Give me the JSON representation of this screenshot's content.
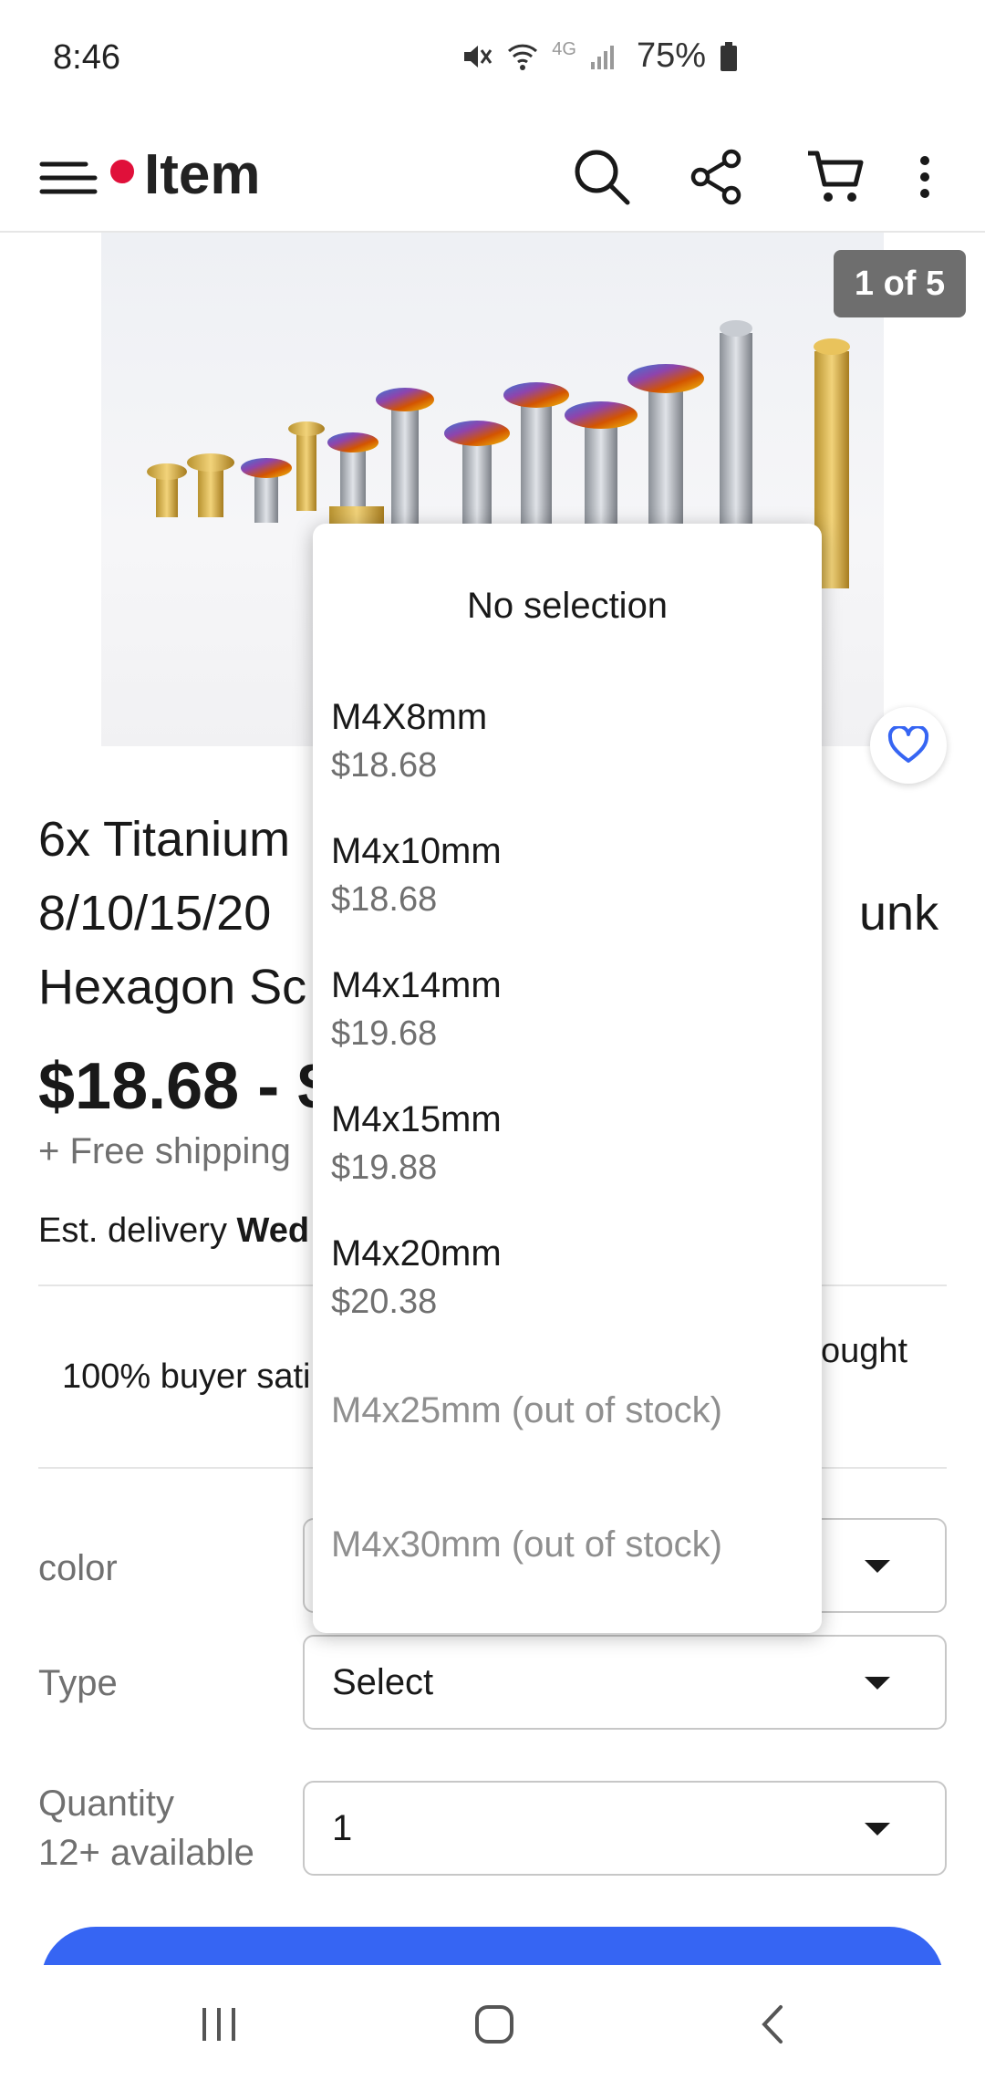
{
  "status_bar": {
    "time": "8:46",
    "network": "4G",
    "battery": "75%"
  },
  "app_bar": {
    "title": "Item",
    "icons": [
      "menu-icon",
      "search-icon",
      "share-icon",
      "cart-icon",
      "more-vert-icon"
    ],
    "notification_dot_color": "#e0103a"
  },
  "image": {
    "counter": "1 of 5"
  },
  "listing": {
    "title": "6x Titanium M4 8/10/15/20 Countersunk Hexagon Screws",
    "title_line1_left": "6x Titanium",
    "title_line2_left": "8/10/15/20",
    "title_line2_right": "unk",
    "title_line3_left": "Hexagon Sc",
    "price": "$18.68 - $",
    "shipping": "+ Free shipping",
    "delivery_prefix": "Est. delivery ",
    "delivery_date": "Wed",
    "guarantee_left": "100% buyer sati",
    "guarantee_right": "ought"
  },
  "variations": {
    "color_label": "color",
    "type_label": "Type",
    "type_value": "Select",
    "quantity_label": "Quantity",
    "quantity_available": "12+ available",
    "quantity_value": "1"
  },
  "dropdown": {
    "no_selection": "No selection",
    "options": [
      {
        "name": "M4X8mm",
        "price": "$18.68"
      },
      {
        "name": "M4x10mm",
        "price": "$18.68"
      },
      {
        "name": "M4x14mm",
        "price": "$19.68"
      },
      {
        "name": "M4x15mm",
        "price": "$19.88"
      },
      {
        "name": "M4x20mm",
        "price": "$20.38"
      }
    ],
    "out_of_stock": [
      "M4x25mm (out of stock)",
      "M4x30mm (out of stock)"
    ]
  },
  "colors": {
    "accent_blue": "#3665f3",
    "price_gray": "#707070"
  }
}
